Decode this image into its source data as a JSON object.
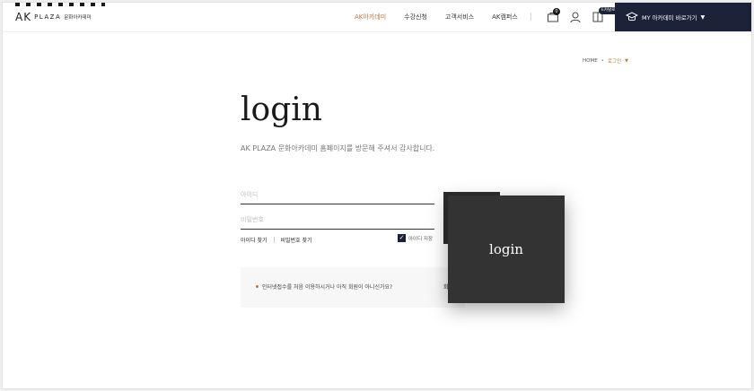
{
  "header": {
    "logo": {
      "ak": "AK",
      "plaza": "PLAZA",
      "ko": "문화아카데미"
    },
    "nav": [
      "AK아카데미",
      "수강신청",
      "고객서비스",
      "AK캠퍼스"
    ],
    "cart_count": "0",
    "cart_tag": "E카탈로그",
    "my_button": "MY 아카데미 바로가기",
    "accent_color": "#b8763f",
    "navy_color": "#1c2338"
  },
  "breadcrumb": {
    "home": "HOME",
    "current": "로그인"
  },
  "login": {
    "title": "login",
    "subtitle": "AK PLAZA 문화아카데미 홈페이지를 방문해 주셔서 감사합니다.",
    "id_placeholder": "아이디",
    "pw_placeholder": "비밀번호",
    "find_id": "아이디 찾기",
    "find_pw": "비밀번호 찾기",
    "save_id": "아이디 저장",
    "save_checked": true,
    "join_message": "인터넷접수를 처음 이용하시거나 아직 회원이 아니신가요?",
    "join_label": "회",
    "popup_button": "login"
  }
}
